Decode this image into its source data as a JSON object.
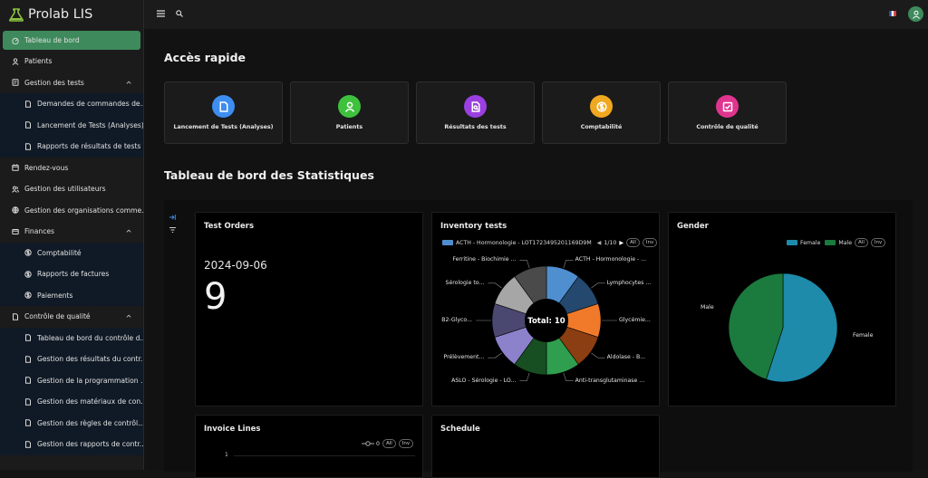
{
  "brand": {
    "title": "Prolab LIS",
    "accent": "#8ac43f"
  },
  "sidebar": {
    "items": [
      {
        "label": "Tableau de bord",
        "icon": "dashboard-icon",
        "active": true
      },
      {
        "label": "Patients",
        "icon": "user-icon"
      },
      {
        "label": "Gestion des tests",
        "icon": "test-icon",
        "expanded": true,
        "children": [
          {
            "label": "Demandes de commandes de..."
          },
          {
            "label": "Lancement de Tests (Analyses)"
          },
          {
            "label": "Rapports de résultats de tests"
          }
        ]
      },
      {
        "label": "Rendez-vous",
        "icon": "calendar-icon"
      },
      {
        "label": "Gestion des utilisateurs",
        "icon": "users-icon"
      },
      {
        "label": "Gestion des organisations comme...",
        "icon": "globe-icon"
      },
      {
        "label": "Finances",
        "icon": "finance-icon",
        "expanded": true,
        "children": [
          {
            "label": "Comptabilité"
          },
          {
            "label": "Rapports de factures"
          },
          {
            "label": "Paiements"
          }
        ]
      },
      {
        "label": "Contrôle de qualité",
        "icon": "document-icon",
        "expanded": true,
        "children": [
          {
            "label": "Tableau de bord du contrôle d..."
          },
          {
            "label": "Gestion des résultats du contr..."
          },
          {
            "label": "Gestion de la programmation ..."
          },
          {
            "label": "Gestion des matériaux de con..."
          },
          {
            "label": "Gestion des règles de contrôl..."
          },
          {
            "label": "Gestion des rapports de contr..."
          }
        ]
      }
    ]
  },
  "main": {
    "quick_title": "Accès rapide",
    "quick": [
      {
        "label": "Lancement de Tests (Analyses)",
        "icon": "document-icon",
        "color": "#3d8ef0"
      },
      {
        "label": "Patients",
        "icon": "user-icon",
        "color": "#3ec23e"
      },
      {
        "label": "Résultats des tests",
        "icon": "results-icon",
        "color": "#9a3fe0"
      },
      {
        "label": "Comptabilité",
        "icon": "dollar-icon",
        "color": "#f0a820"
      },
      {
        "label": "Contrôle de qualité",
        "icon": "check-icon",
        "color": "#e0358f"
      }
    ],
    "stats_title": "Tableau de bord des Statistiques"
  },
  "cards": {
    "test_orders": {
      "title": "Test Orders",
      "date": "2024-09-06",
      "value": "9"
    },
    "inventory": {
      "title": "Inventory tests",
      "legend": "ACTH - Hormonologie - LOT1723495201169D9M",
      "page": "1/10",
      "total_label": "Total: 10",
      "all": "All",
      "inv": "Inv"
    },
    "gender": {
      "title": "Gender",
      "legend_female": "Female",
      "legend_male": "Male",
      "all": "All",
      "inv": "Inv",
      "label_male": "Male",
      "label_female": "Female"
    },
    "invoice": {
      "title": "Invoice Lines",
      "legend_value": "0",
      "all": "All",
      "inv": "Inv",
      "axis_tick": "1"
    },
    "schedule": {
      "title": "Schedule"
    }
  },
  "chart_data": [
    {
      "type": "pie",
      "title": "Inventory tests",
      "total": 10,
      "categories": [
        "ACTH - Hormonologie - ...",
        "Lymphocytes ...",
        "Glycémie...",
        "Aldolase - B...",
        "Anti-transglutaminase ...",
        "ASLO - Sérologie - LO...",
        "Prélèvement...",
        "B2-Glyco...",
        "Sérologie to...",
        "Ferritine - Biochimie ..."
      ],
      "values": [
        1,
        1,
        1,
        1,
        1,
        1,
        1,
        1,
        1,
        1
      ],
      "colors": [
        "#4f8fd0",
        "#24486e",
        "#f07a2a",
        "#8a3e12",
        "#2f9e4f",
        "#184f22",
        "#8c82cc",
        "#4a4870",
        "#a6a6a6",
        "#4a4a4a"
      ]
    },
    {
      "type": "pie",
      "title": "Gender",
      "categories": [
        "Female",
        "Male"
      ],
      "values": [
        55,
        45
      ],
      "colors": [
        "#1e8bab",
        "#1b7a3d"
      ]
    }
  ]
}
